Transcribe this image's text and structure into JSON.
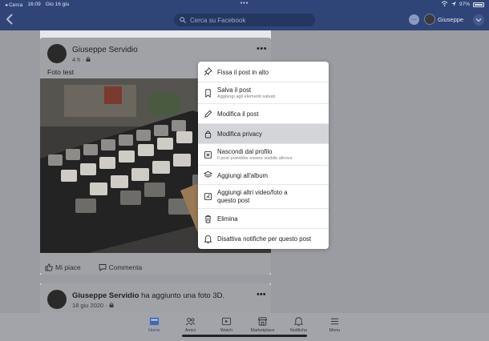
{
  "status_bar": {
    "back_app": "◂ Cerca",
    "time": "16:09",
    "date": "Gio 16 giu",
    "dots": "•••",
    "battery": "97%"
  },
  "header": {
    "search_placeholder": "Cerca su Facebook",
    "user_name": "Giuseppe"
  },
  "post": {
    "author": "Giuseppe Servidio",
    "time": "4 h ·",
    "more": "•••",
    "text": "Foto test",
    "like_label": "Mi piace",
    "comment_label": "Commenta"
  },
  "post2": {
    "author": "Giuseppe Servidio",
    "action": "ha aggiunto una foto 3D.",
    "date": "18 giu 2020 ·",
    "more": "•••"
  },
  "menu": {
    "items": [
      {
        "label": "Fissa il post in alto",
        "sub": "",
        "icon": "pin-icon"
      },
      {
        "label": "Salva il post",
        "sub": "Aggiungi agli elementi salvati.",
        "icon": "bookmark-icon"
      },
      {
        "label": "Modifica il post",
        "sub": "",
        "icon": "pencil-icon"
      },
      {
        "label": "Modifica privacy",
        "sub": "",
        "icon": "lock-icon"
      },
      {
        "label": "Nascondi dal profilo",
        "sub": "Il post potrebbe essere visibile altrove.",
        "icon": "hide-icon"
      },
      {
        "label": "Aggiungi all'album",
        "sub": "",
        "icon": "album-icon"
      },
      {
        "label": "Aggiungi altri video/foto a",
        "label2": "questo post",
        "sub": "",
        "icon": "add-media-icon"
      },
      {
        "label": "Elimina",
        "sub": "",
        "icon": "trash-icon"
      },
      {
        "label": "Disattiva notifiche per questo post",
        "sub": "",
        "icon": "bell-off-icon"
      }
    ]
  },
  "tabs": [
    {
      "label": "Home",
      "icon": "home-icon",
      "active": true
    },
    {
      "label": "Amici",
      "icon": "friends-icon"
    },
    {
      "label": "Watch",
      "icon": "watch-icon"
    },
    {
      "label": "Marketplace",
      "icon": "marketplace-icon"
    },
    {
      "label": "Notifiche",
      "icon": "bell-icon"
    },
    {
      "label": "Menu",
      "icon": "menu-icon"
    }
  ],
  "colors": {
    "header_bg": "#2f4578",
    "active_tab": "#2f4d8a",
    "menu_highlight": "#d3d5d9"
  }
}
